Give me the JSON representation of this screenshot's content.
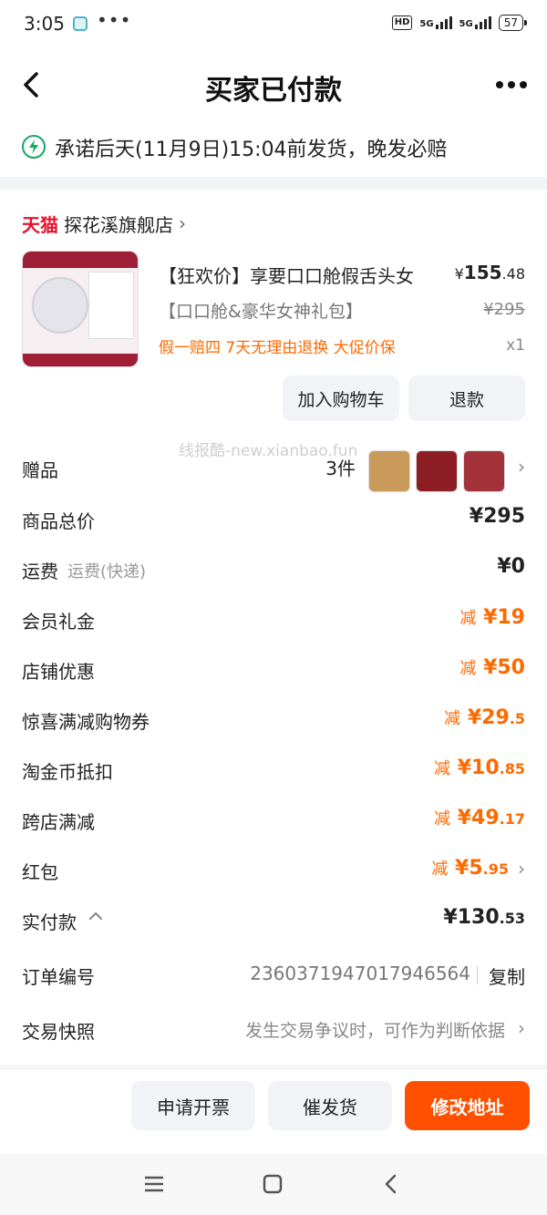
{
  "status_bar": {
    "time": "3:05",
    "dots": "•••",
    "hd": "HD",
    "network1": "5G",
    "network2": "5G",
    "battery": "57"
  },
  "header": {
    "title": "买家已付款"
  },
  "promise": {
    "text": "承诺后天(11月9日)15:04前发货，晚发必赔"
  },
  "shop": {
    "logo_text": "天猫",
    "name": "探花溪旗舰店",
    "chevron": "›"
  },
  "product": {
    "title": "【狂欢价】享要口口舱假舌头女",
    "price_currency": "¥",
    "price_int": "155",
    "price_dec": ".48",
    "sku": "【口口舱&豪华女神礼包】",
    "original_price": "¥295",
    "tags": "假一赔四  7天无理由退换  大促价保",
    "quantity": "x1"
  },
  "actions": {
    "add_to_cart": "加入购物车",
    "refund": "退款"
  },
  "watermark": "线报酷-new.xianbao.fun",
  "summary": {
    "gifts_label": "赠品",
    "gifts_count": "3件",
    "total_label": "商品总价",
    "total_value": "¥295",
    "shipping_label": "运费",
    "shipping_sub": "运费(快递)",
    "shipping_value": "¥0",
    "discounts": [
      {
        "label": "会员礼金",
        "prefix": "减",
        "value": "¥19",
        "small": ""
      },
      {
        "label": "店铺优惠",
        "prefix": "减",
        "value": "¥50",
        "small": ""
      },
      {
        "label": "惊喜满减购物券",
        "prefix": "减",
        "value": "¥29",
        "small": ".5"
      },
      {
        "label": "淘金币抵扣",
        "prefix": "减",
        "value": "¥10",
        "small": ".85"
      },
      {
        "label": "跨店满减",
        "prefix": "减",
        "value": "¥49",
        "small": ".17"
      },
      {
        "label": "红包",
        "prefix": "减",
        "value": "¥5",
        "small": ".95"
      }
    ],
    "paid_label": "实付款",
    "paid_value": "¥130",
    "paid_small": ".53"
  },
  "order": {
    "number_label": "订单编号",
    "number": "2360371947017946564",
    "copy": "复制",
    "snapshot_label": "交易快照",
    "snapshot_text": "发生交易争议时，可作为判断依据"
  },
  "bottom_actions": {
    "invoice": "申请开票",
    "urge": "催发货",
    "modify_address": "修改地址"
  },
  "colors": {
    "accent_orange": "#ff5000",
    "discount_orange": "#ff6a00",
    "tmall_red": "#e8102b",
    "promise_green": "#17a865"
  }
}
